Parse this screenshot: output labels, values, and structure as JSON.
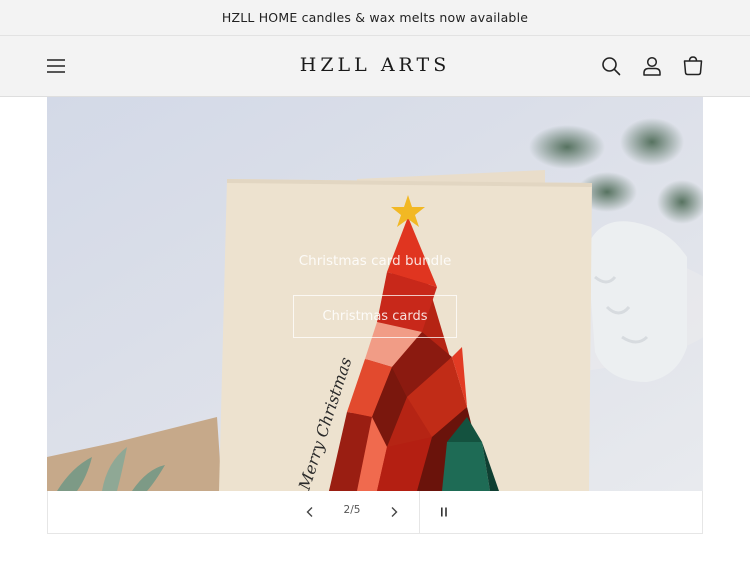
{
  "announcement": {
    "text": "HZLL HOME candles & wax melts now available"
  },
  "header": {
    "logo": "HZLL ARTS",
    "icons": {
      "menu": "hamburger-menu-icon",
      "search": "search-icon",
      "account": "account-icon",
      "cart": "cart-icon"
    }
  },
  "slideshow": {
    "heading": "Christmas card bundle",
    "button_label": "Christmas cards",
    "card_script_text": "Merry Christmas",
    "counter": "2/5",
    "icons": {
      "prev": "chevron-left-icon",
      "next": "chevron-right-icon",
      "pause": "pause-icon"
    }
  },
  "colors": {
    "background": "#ffffff",
    "bar": "#f3f3f3",
    "card": "#ede2cf",
    "tree_red": "#c8281a",
    "tree_green": "#1e6b55",
    "star": "#f2b824"
  }
}
